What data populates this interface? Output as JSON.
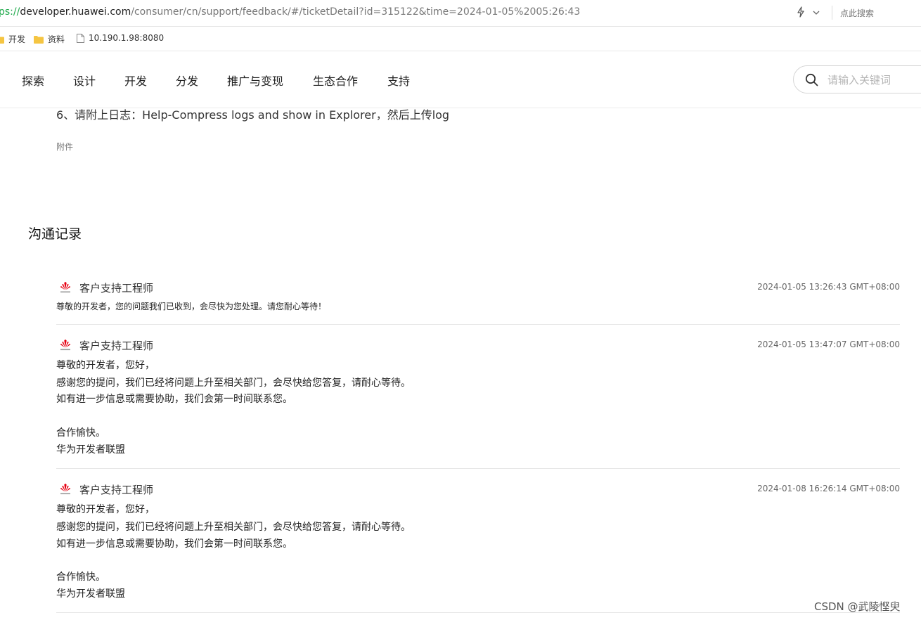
{
  "browser": {
    "url_scheme": "ps://",
    "url_domain": "developer.huawei.com",
    "url_path": "/consumer/cn/support/feedback/#/ticketDetail?id=315122&time=2024-01-05%2005:26:43",
    "search_placeholder": "点此搜索",
    "bookmarks": [
      {
        "label": "开发",
        "icon": "folder-icon"
      },
      {
        "label": "资料",
        "icon": "folder-icon"
      },
      {
        "label": "10.190.1.98:8080",
        "icon": "page-icon"
      }
    ]
  },
  "nav": {
    "items": [
      "探索",
      "设计",
      "开发",
      "分发",
      "推广与变现",
      "生态合作",
      "支持"
    ],
    "search_placeholder": "请输入关键词"
  },
  "ticket": {
    "description_line": "6、请附上日志：Help-Compress logs and show in Explorer，然后上传log",
    "attachment_label": "附件"
  },
  "records": {
    "title": "沟通记录",
    "items": [
      {
        "author": "客户支持工程师",
        "time": "2024-01-05 13:26:43 GMT+08:00",
        "lines": [
          "尊敬的开发者，您的问题我们已收到，会尽快为您处理。请您耐心等待！"
        ]
      },
      {
        "author": "客户支持工程师",
        "time": "2024-01-05 13:47:07 GMT+08:00",
        "lines": [
          "尊敬的开发者，您好，",
          "感谢您的提问，我们已经将问题上升至相关部门，会尽快给您答复，请耐心等待。",
          "如有进一步信息或需要协助，我们会第一时间联系您。",
          "合作愉快。",
          "华为开发者联盟"
        ]
      },
      {
        "author": "客户支持工程师",
        "time": "2024-01-08 16:26:14 GMT+08:00",
        "lines": [
          "尊敬的开发者，您好，",
          "感谢您的提问，我们已经将问题上升至相关部门，会尽快给您答复，请耐心等待。",
          "如有进一步信息或需要协助，我们会第一时间联系您。",
          "合作愉快。",
          "华为开发者联盟"
        ]
      }
    ]
  },
  "watermark": "CSDN @武陵悭臾",
  "colors": {
    "brand": "#e60012",
    "url_scheme": "#1ea94b",
    "folder": "#f5c542"
  }
}
